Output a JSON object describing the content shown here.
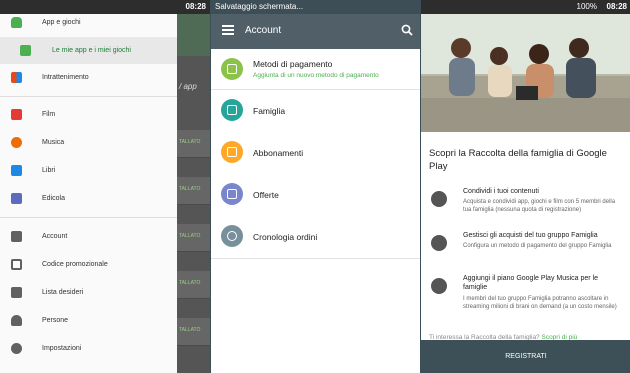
{
  "panel1": {
    "status_time": "08:28",
    "drawer_items": [
      {
        "label": "App e giochi",
        "icon": "android-icon",
        "color": "#4caf50"
      },
      {
        "label": "Le mie app e i miei giochi",
        "icon": "my-apps-icon",
        "color": "#4caf50",
        "selected": true
      },
      {
        "label": "Intrattenimento",
        "icon": "entertainment-icon",
        "color": "#e64a19"
      },
      {
        "label": "Film",
        "icon": "movie-icon",
        "color": "#e53935"
      },
      {
        "label": "Musica",
        "icon": "music-icon",
        "color": "#ef6c00"
      },
      {
        "label": "Libri",
        "icon": "book-icon",
        "color": "#1e88e5"
      },
      {
        "label": "Edicola",
        "icon": "newsstand-icon",
        "color": "#5c6bc0"
      },
      {
        "label": "Account",
        "icon": "account-icon",
        "color": "#616161"
      },
      {
        "label": "Codice promozionale",
        "icon": "promo-code-icon",
        "color": "#616161"
      },
      {
        "label": "Lista desideri",
        "icon": "wishlist-icon",
        "color": "#616161"
      },
      {
        "label": "Persone",
        "icon": "people-icon",
        "color": "#616161"
      },
      {
        "label": "Impostazioni",
        "icon": "settings-icon",
        "color": "#616161"
      }
    ],
    "bg_heading": "/ app",
    "bg_row_label": "TALLATO"
  },
  "panel2": {
    "status_text": "Salvataggio schermata...",
    "header_title": "Account",
    "items": [
      {
        "label": "Metodi di pagamento",
        "sub": "Aggiunta di un nuovo metodo di pagamento",
        "icon": "payment-card-icon",
        "color": "#8bc34a"
      },
      {
        "label": "Famiglia",
        "sub": "",
        "icon": "family-home-icon",
        "color": "#26a69a"
      },
      {
        "label": "Abbonamenti",
        "sub": "",
        "icon": "subscription-icon",
        "color": "#ffa726"
      },
      {
        "label": "Offerte",
        "sub": "",
        "icon": "gift-icon",
        "color": "#7986cb"
      },
      {
        "label": "Cronologia ordini",
        "sub": "",
        "icon": "history-icon",
        "color": "#78909c"
      }
    ]
  },
  "panel3": {
    "status_battery": "100%",
    "status_time": "08:28",
    "title": "Scopri la Raccolta della famiglia di Google Play",
    "features": [
      {
        "heading": "Condividi i tuoi contenuti",
        "desc": "Acquista e condividi app, giochi e film con 5 membri della tua famiglia (nessuna quota di registrazione)",
        "icon": "family-home-icon"
      },
      {
        "heading": "Gestisci gli acquisti del tuo gruppo Famiglia",
        "desc": "Configura un metodo di pagamento del gruppo Famiglia",
        "icon": "payment-card-icon"
      },
      {
        "heading": "Aggiungi il piano Google Play Musica per le famiglie",
        "desc": "I membri del tuo gruppo Famiglia potranno ascoltare in streaming milioni di brani on demand (a un costo mensile)",
        "icon": "music-icon"
      }
    ],
    "link_prefix": "Ti interessa la Raccolta della famiglia?",
    "link_text": "Scopri di più",
    "register_label": "REGISTRATI"
  }
}
